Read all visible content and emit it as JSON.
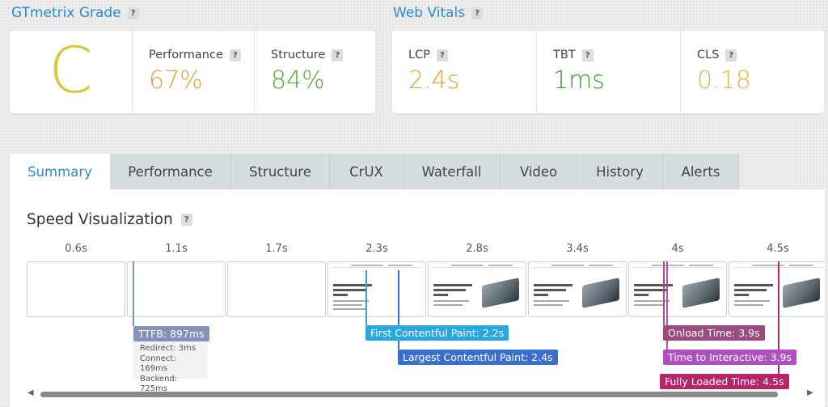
{
  "grade": {
    "title": "GTmetrix Grade",
    "help": "?",
    "letter": "C",
    "letter_color": "#d7c93c",
    "metrics": [
      {
        "label": "Performance",
        "help": "?",
        "value": "67%",
        "color": "#e0a33c"
      },
      {
        "label": "Structure",
        "help": "?",
        "value": "84%",
        "color": "#5aaa3c"
      }
    ]
  },
  "vitals": {
    "title": "Web Vitals",
    "help": "?",
    "metrics": [
      {
        "label": "LCP",
        "help": "?",
        "value": "2.4s",
        "color": "#e0a33c"
      },
      {
        "label": "TBT",
        "help": "?",
        "value": "1ms",
        "color": "#3f9b32"
      },
      {
        "label": "CLS",
        "help": "?",
        "value": "0.18",
        "color": "#e8b548"
      }
    ]
  },
  "tabs": [
    {
      "label": "Summary",
      "active": true
    },
    {
      "label": "Performance"
    },
    {
      "label": "Structure"
    },
    {
      "label": "CrUX"
    },
    {
      "label": "Waterfall"
    },
    {
      "label": "Video"
    },
    {
      "label": "History"
    },
    {
      "label": "Alerts"
    }
  ],
  "speed_visualization": {
    "title": "Speed Visualization",
    "help": "?",
    "frames": [
      {
        "time": "0.6s",
        "content": "blank"
      },
      {
        "time": "1.1s",
        "content": "blank"
      },
      {
        "time": "1.7s",
        "content": "blank"
      },
      {
        "time": "2.3s",
        "content": "page"
      },
      {
        "time": "2.8s",
        "content": "page"
      },
      {
        "time": "3.4s",
        "content": "page"
      },
      {
        "time": "4s",
        "content": "page"
      },
      {
        "time": "4.5s",
        "content": "page"
      }
    ],
    "markers": {
      "ttfb": {
        "label": "TTFB: 897ms",
        "color": "#8392b6",
        "details": [
          "Redirect: 3ms",
          "Connect: 169ms",
          "Backend: 725ms"
        ]
      },
      "fcp": {
        "label": "First Contentful Paint: 2.2s",
        "color": "#2aa7de"
      },
      "lcp": {
        "label": "Largest Contentful Paint: 2.4s",
        "color": "#3b6fcf"
      },
      "onload": {
        "label": "Onload Time: 3.9s",
        "color": "#9b4c7e"
      },
      "tti": {
        "label": "Time to Interactive: 3.9s",
        "color": "#b04fc0"
      },
      "fully_loaded": {
        "label": "Fully Loaded Time: 4.5s",
        "color": "#b8246a"
      }
    },
    "scroll_left": "◀",
    "scroll_right": "▶"
  }
}
